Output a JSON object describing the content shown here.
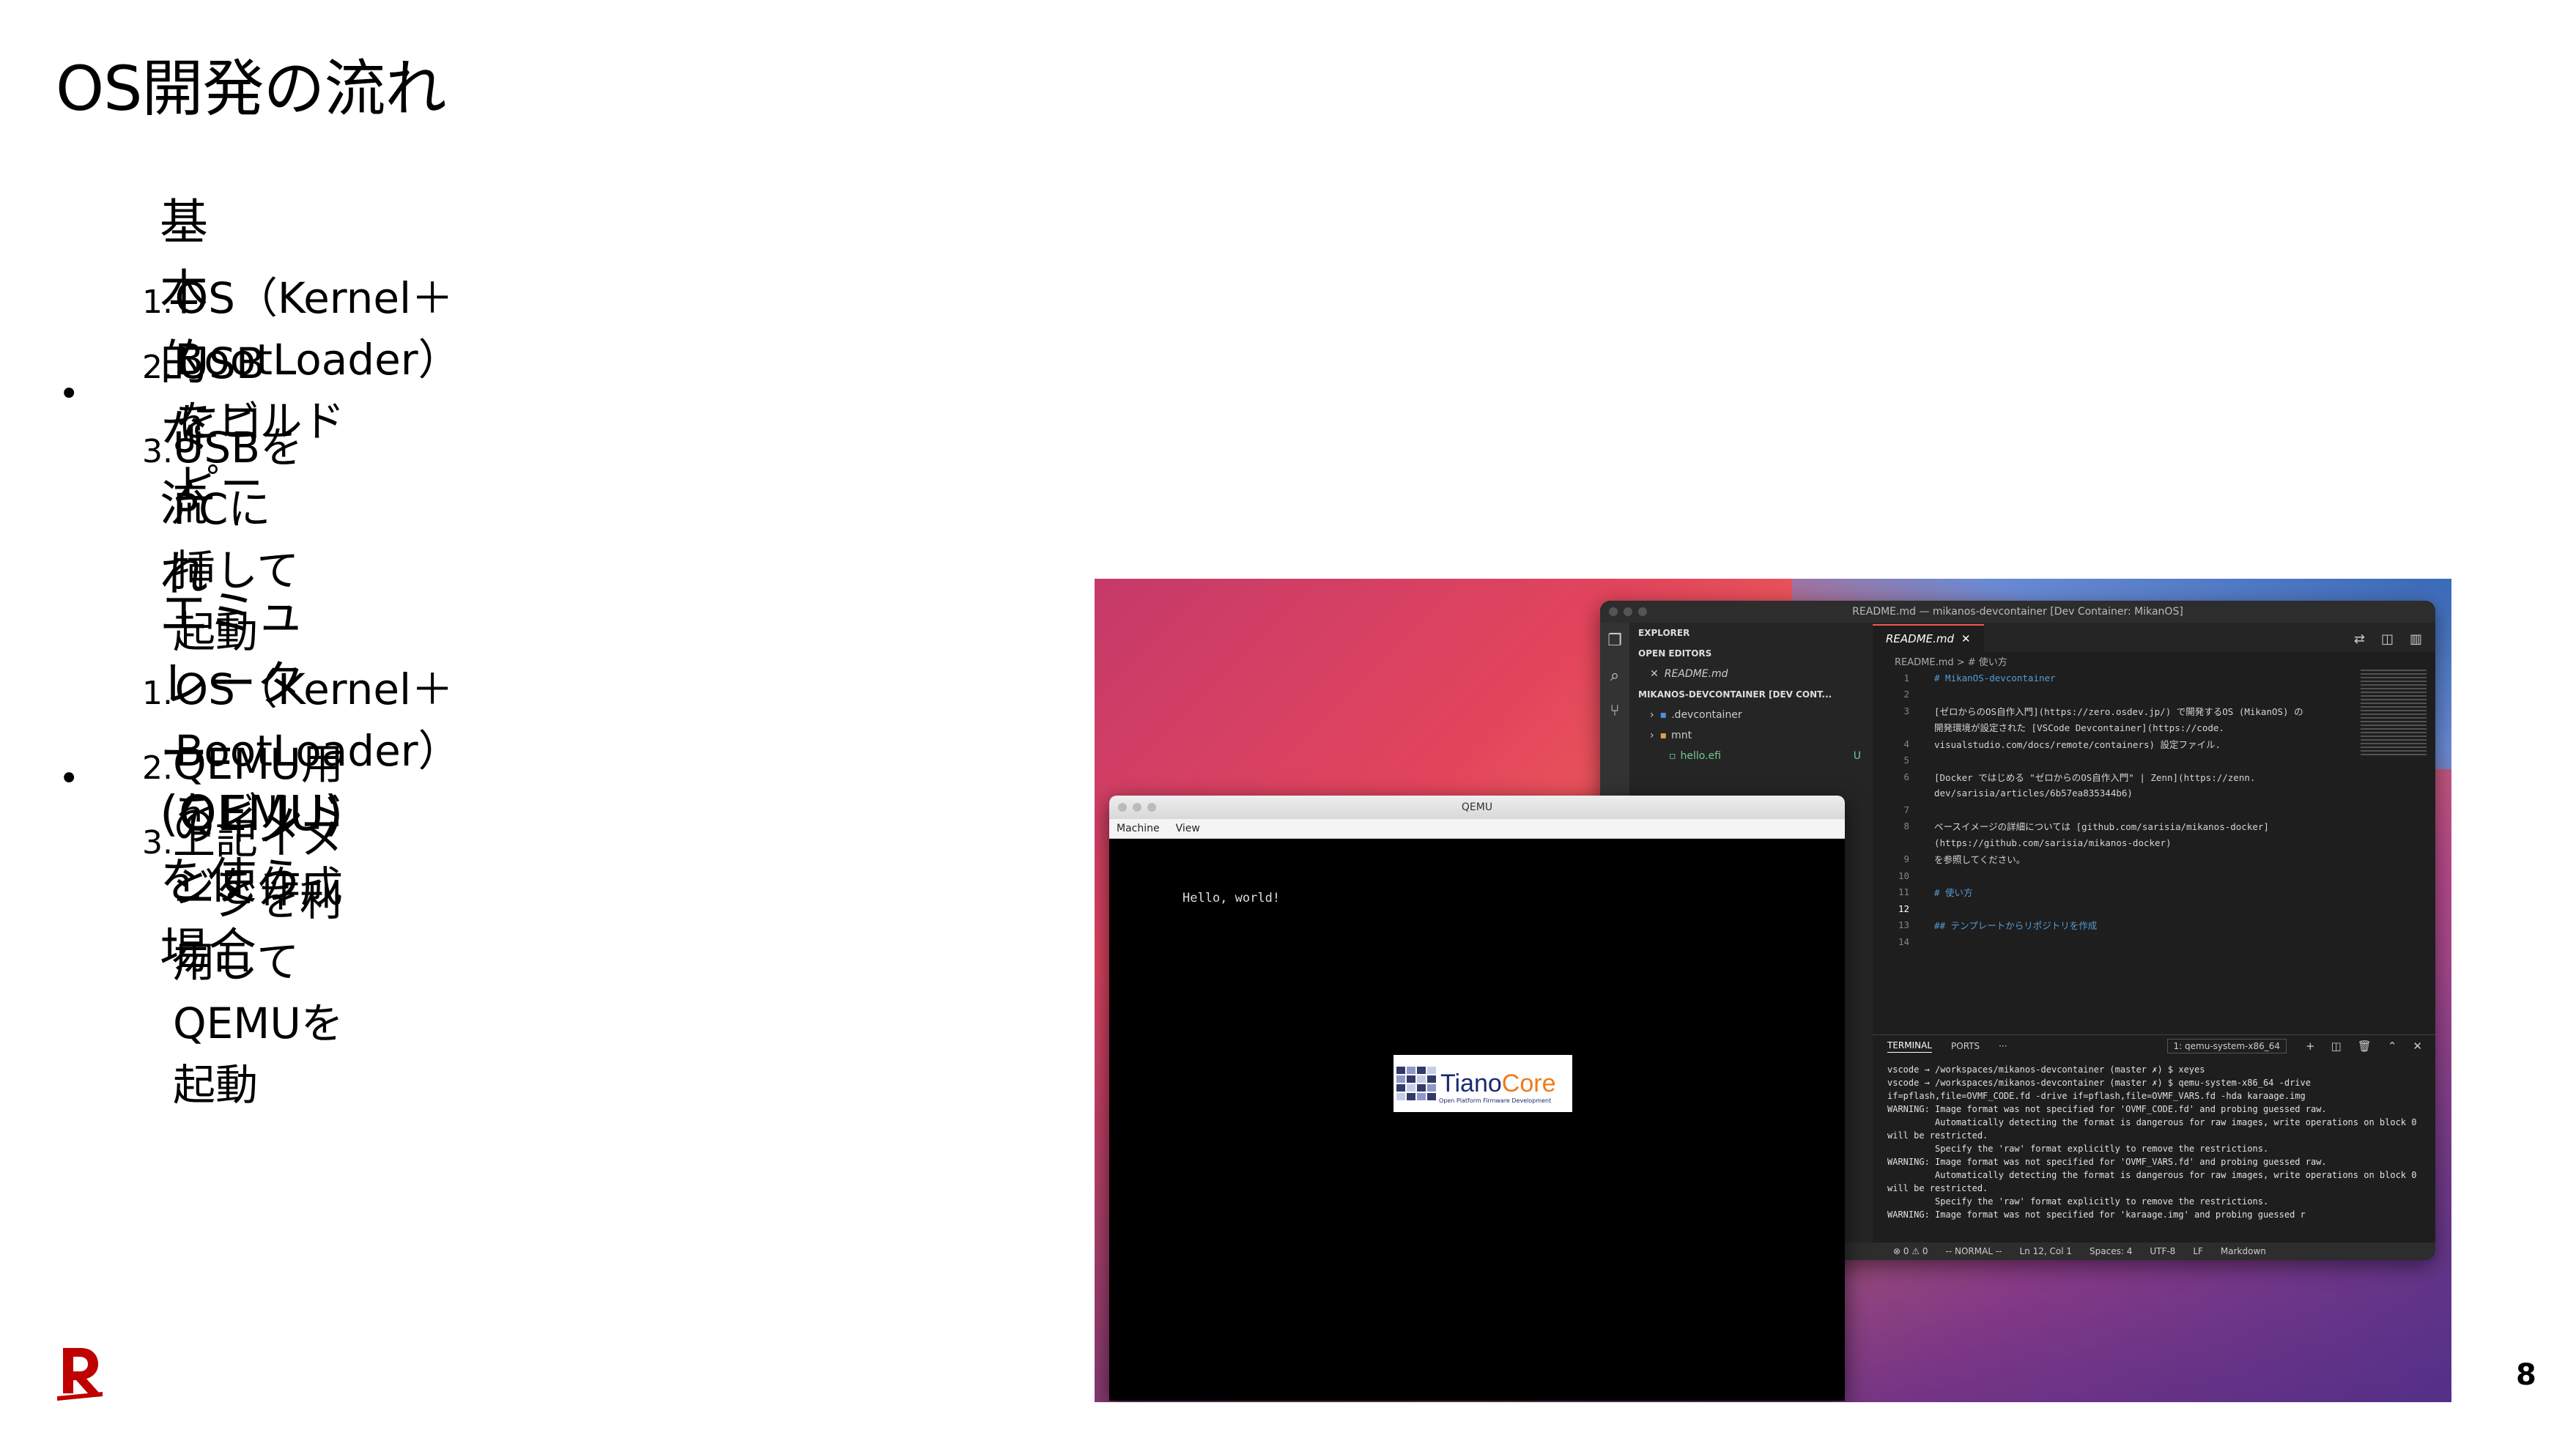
{
  "slide": {
    "title": "OS開発の流れ",
    "page_number": "8",
    "sections": [
      {
        "heading": "基本的な流れ",
        "steps": [
          {
            "num": "1.",
            "text": "OS（Kernel＋BootLoader）をビルド"
          },
          {
            "num": "2.",
            "text": "USBにコピー"
          },
          {
            "num": "3.",
            "text": "USBをPCに挿して起動"
          }
        ]
      },
      {
        "heading": "エミュレーター(QEMU)を使う場合",
        "steps": [
          {
            "num": "1.",
            "text": "OS（Kernel＋BootLoader）をビルド"
          },
          {
            "num": "2.",
            "text": "QEMU用のイメージを作成"
          },
          {
            "num": "3.",
            "text": "上記イメージを利用してQEMUを起動"
          }
        ]
      }
    ]
  },
  "vscode": {
    "window_title": "README.md — mikanos-devcontainer [Dev Container: MikanOS]",
    "explorer": {
      "header": "EXPLORER",
      "open_editors": "OPEN EDITORS",
      "open_file": "README.md",
      "workspace": "MIKANOS-DEVCONTAINER [DEV CONT...",
      "items": [
        ".devcontainer",
        "mnt",
        "hello.efi"
      ],
      "hello_status": "U"
    },
    "tab": "README.md",
    "breadcrumb": "README.md > # 使い方",
    "code_lines": [
      {
        "n": "1",
        "t": "# MikanOS-devcontainer"
      },
      {
        "n": "2",
        "t": ""
      },
      {
        "n": "3",
        "t": "[ゼロからのOS自作入門](https://zero.osdev.jp/) で開発するOS (MikanOS) の"
      },
      {
        "n": "",
        "t": "開発環境が設定された [VSCode Devcontainer](https://code."
      },
      {
        "n": "4",
        "t": "visualstudio.com/docs/remote/containers) 設定ファイル."
      },
      {
        "n": "5",
        "t": ""
      },
      {
        "n": "6",
        "t": "[Docker ではじめる \"ゼロからのOS自作入門\" | Zenn](https://zenn."
      },
      {
        "n": "",
        "t": "dev/sarisia/articles/6b57ea835344b6)"
      },
      {
        "n": "7",
        "t": ""
      },
      {
        "n": "8",
        "t": "ベースイメージの詳細については [github.com/sarisia/mikanos-docker]"
      },
      {
        "n": "",
        "t": "(https://github.com/sarisia/mikanos-docker)"
      },
      {
        "n": "9",
        "t": "を参照してください。"
      },
      {
        "n": "10",
        "t": ""
      },
      {
        "n": "11",
        "t": "# 使い方"
      },
      {
        "n": "12",
        "t": ""
      },
      {
        "n": "13",
        "t": "## テンプレートからリポジトリを作成"
      },
      {
        "n": "14",
        "t": ""
      }
    ],
    "terminal": {
      "tabs": [
        "TERMINAL",
        "PORTS"
      ],
      "selector": "1: qemu-system-x86_64",
      "lines": "vscode → /workspaces/mikanos-devcontainer (master ✗) $ xeyes\nvscode → /workspaces/mikanos-devcontainer (master ✗) $ qemu-system-x86_64 -drive if=pflash,file=OVMF_CODE.fd -drive if=pflash,file=OVMF_VARS.fd -hda karaage.img\nWARNING: Image format was not specified for 'OVMF_CODE.fd' and probing guessed raw.\n         Automatically detecting the format is dangerous for raw images, write operations on block 0 will be restricted.\n         Specify the 'raw' format explicitly to remove the restrictions.\nWARNING: Image format was not specified for 'OVMF_VARS.fd' and probing guessed raw.\n         Automatically detecting the format is dangerous for raw images, write operations on block 0 will be restricted.\n         Specify the 'raw' format explicitly to remove the restrictions.\nWARNING: Image format was not specified for 'karaage.img' and probing guessed r"
    },
    "status": [
      "⊗ 0 ⚠ 0",
      "-- NORMAL --",
      "Ln 12, Col 1",
      "Spaces: 4",
      "UTF-8",
      "LF",
      "Markdown"
    ]
  },
  "qemu": {
    "window_title": "QEMU",
    "menu": [
      "Machine",
      "View"
    ],
    "output": "Hello, world!",
    "logo_word1": "Tiano",
    "logo_word2": "Core",
    "logo_tag": "Open Platform Firmware Development"
  },
  "colors": {
    "brand_red": "#bf0000"
  }
}
